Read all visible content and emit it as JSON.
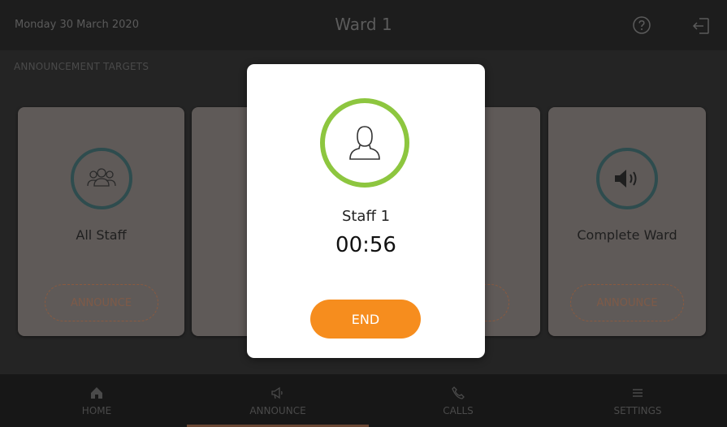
{
  "header": {
    "date": "Monday 30 March 2020",
    "title": "Ward 1",
    "help_icon": "help-icon",
    "logout_icon": "logout-icon"
  },
  "main": {
    "section_label": "ANNOUNCEMENT TARGETS",
    "cards": [
      {
        "label": "All Staff",
        "icon": "group-icon",
        "button": "ANNOUNCE"
      },
      {
        "label": "",
        "icon": "",
        "button": ""
      },
      {
        "label": "",
        "icon": "",
        "button": ""
      },
      {
        "label": "Complete Ward",
        "icon": "speaker-icon",
        "button": "ANNOUNCE"
      }
    ]
  },
  "modal": {
    "avatar_icon": "person-icon",
    "name": "Staff 1",
    "timer": "00:56",
    "end_label": "END"
  },
  "nav": {
    "items": [
      {
        "label": "HOME",
        "icon": "home-icon"
      },
      {
        "label": "ANNOUNCE",
        "icon": "megaphone-icon"
      },
      {
        "label": "CALLS",
        "icon": "phone-icon"
      },
      {
        "label": "SETTINGS",
        "icon": "menu-icon"
      }
    ],
    "active": "ANNOUNCE"
  },
  "colors": {
    "accent_orange": "#f68d1e",
    "ring_green": "#8dc63f",
    "card_bg": "#5f5a58"
  }
}
